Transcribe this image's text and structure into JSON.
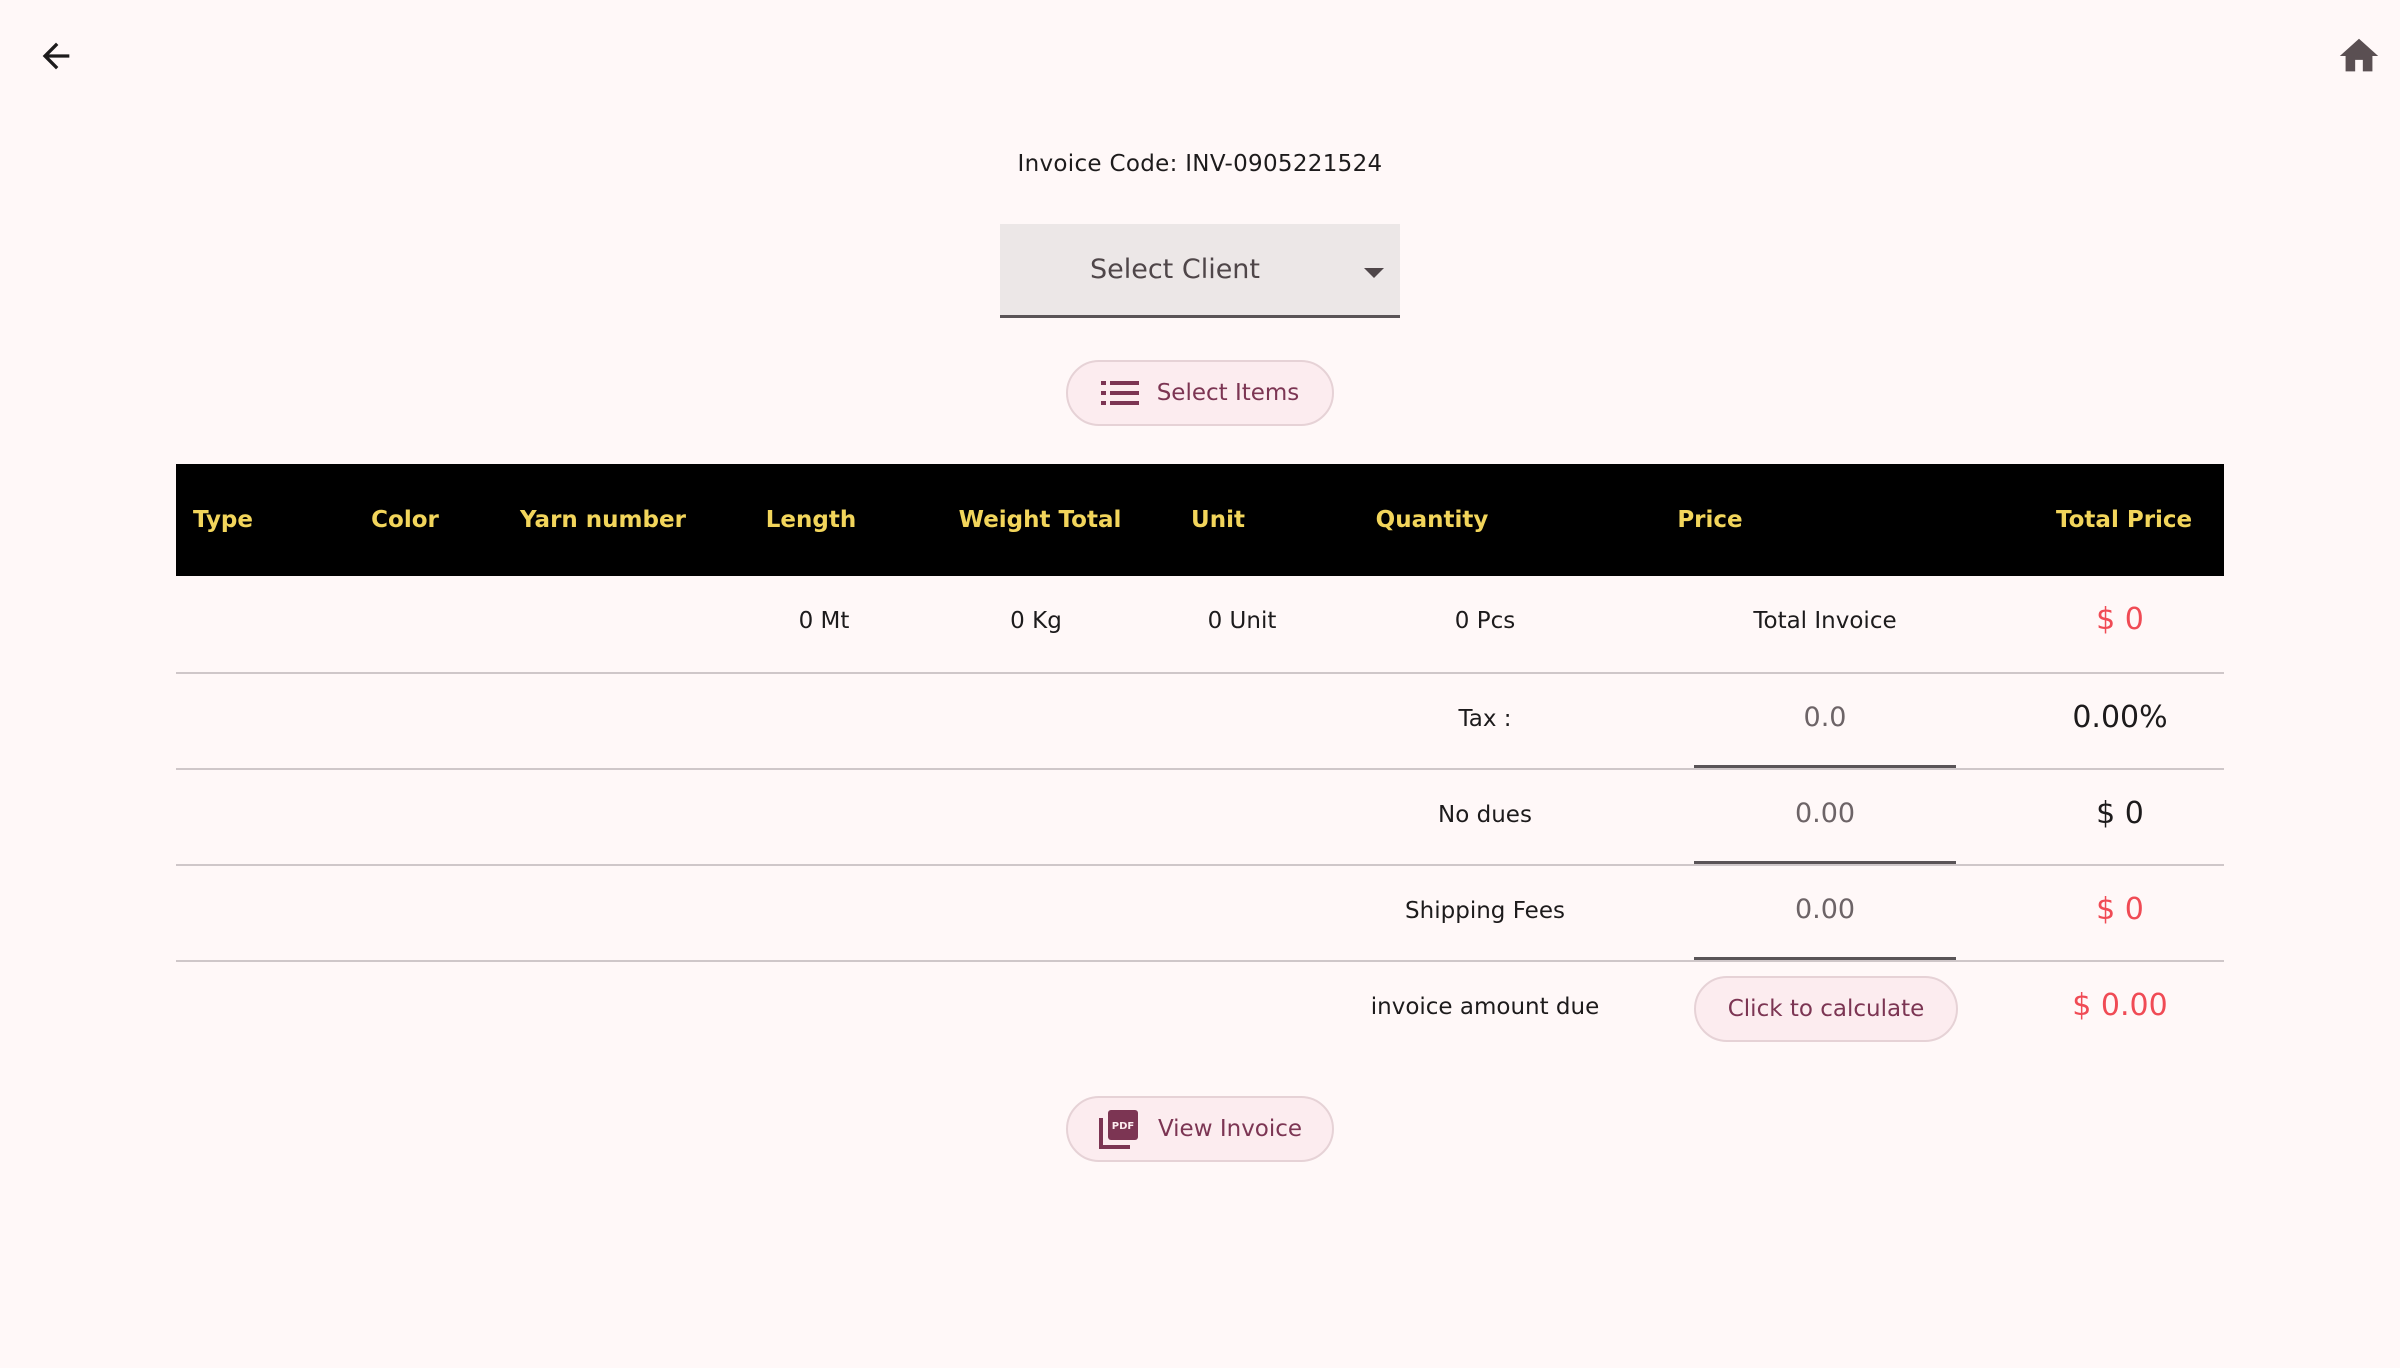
{
  "header": {
    "back_icon": "arrow-left-icon",
    "home_icon": "home-icon"
  },
  "invoice_code": "Invoice Code: INV-0905221524",
  "client_select": {
    "label": "Select Client",
    "icon": "chevron-down-icon"
  },
  "select_items_button": {
    "label": "Select Items",
    "icon": "list-icon"
  },
  "table": {
    "columns": [
      "Type",
      "Color",
      "Yarn number",
      "Length",
      "Weight Total",
      "Unit",
      "Quantity",
      "Price",
      "Total Price"
    ],
    "totals_row": {
      "length": "0 Mt",
      "weight": "0 Kg",
      "unit": "0 Unit",
      "quantity": "0 Pcs",
      "label": "Total  Invoice",
      "total": "$ 0"
    },
    "tax": {
      "label": "Tax :",
      "input_value": "0.0",
      "result": "0.00%"
    },
    "dues": {
      "label": "No dues",
      "input_value": "0.00",
      "result": "$ 0"
    },
    "shipping": {
      "label": "Shipping Fees",
      "input_value": "0.00",
      "result": "$ 0"
    },
    "amount_due": {
      "label": "invoice amount due",
      "button_label": "Click to calculate",
      "result": "$ 0.00"
    }
  },
  "view_invoice_button": {
    "label": "View Invoice",
    "icon": "pdf-icon"
  },
  "colors": {
    "background": "#fff8f8",
    "header_bg": "#000000",
    "header_text": "#f2d55b",
    "accent_red": "#f04b55",
    "button_text": "#7c3553",
    "button_bg": "#fcecef"
  }
}
